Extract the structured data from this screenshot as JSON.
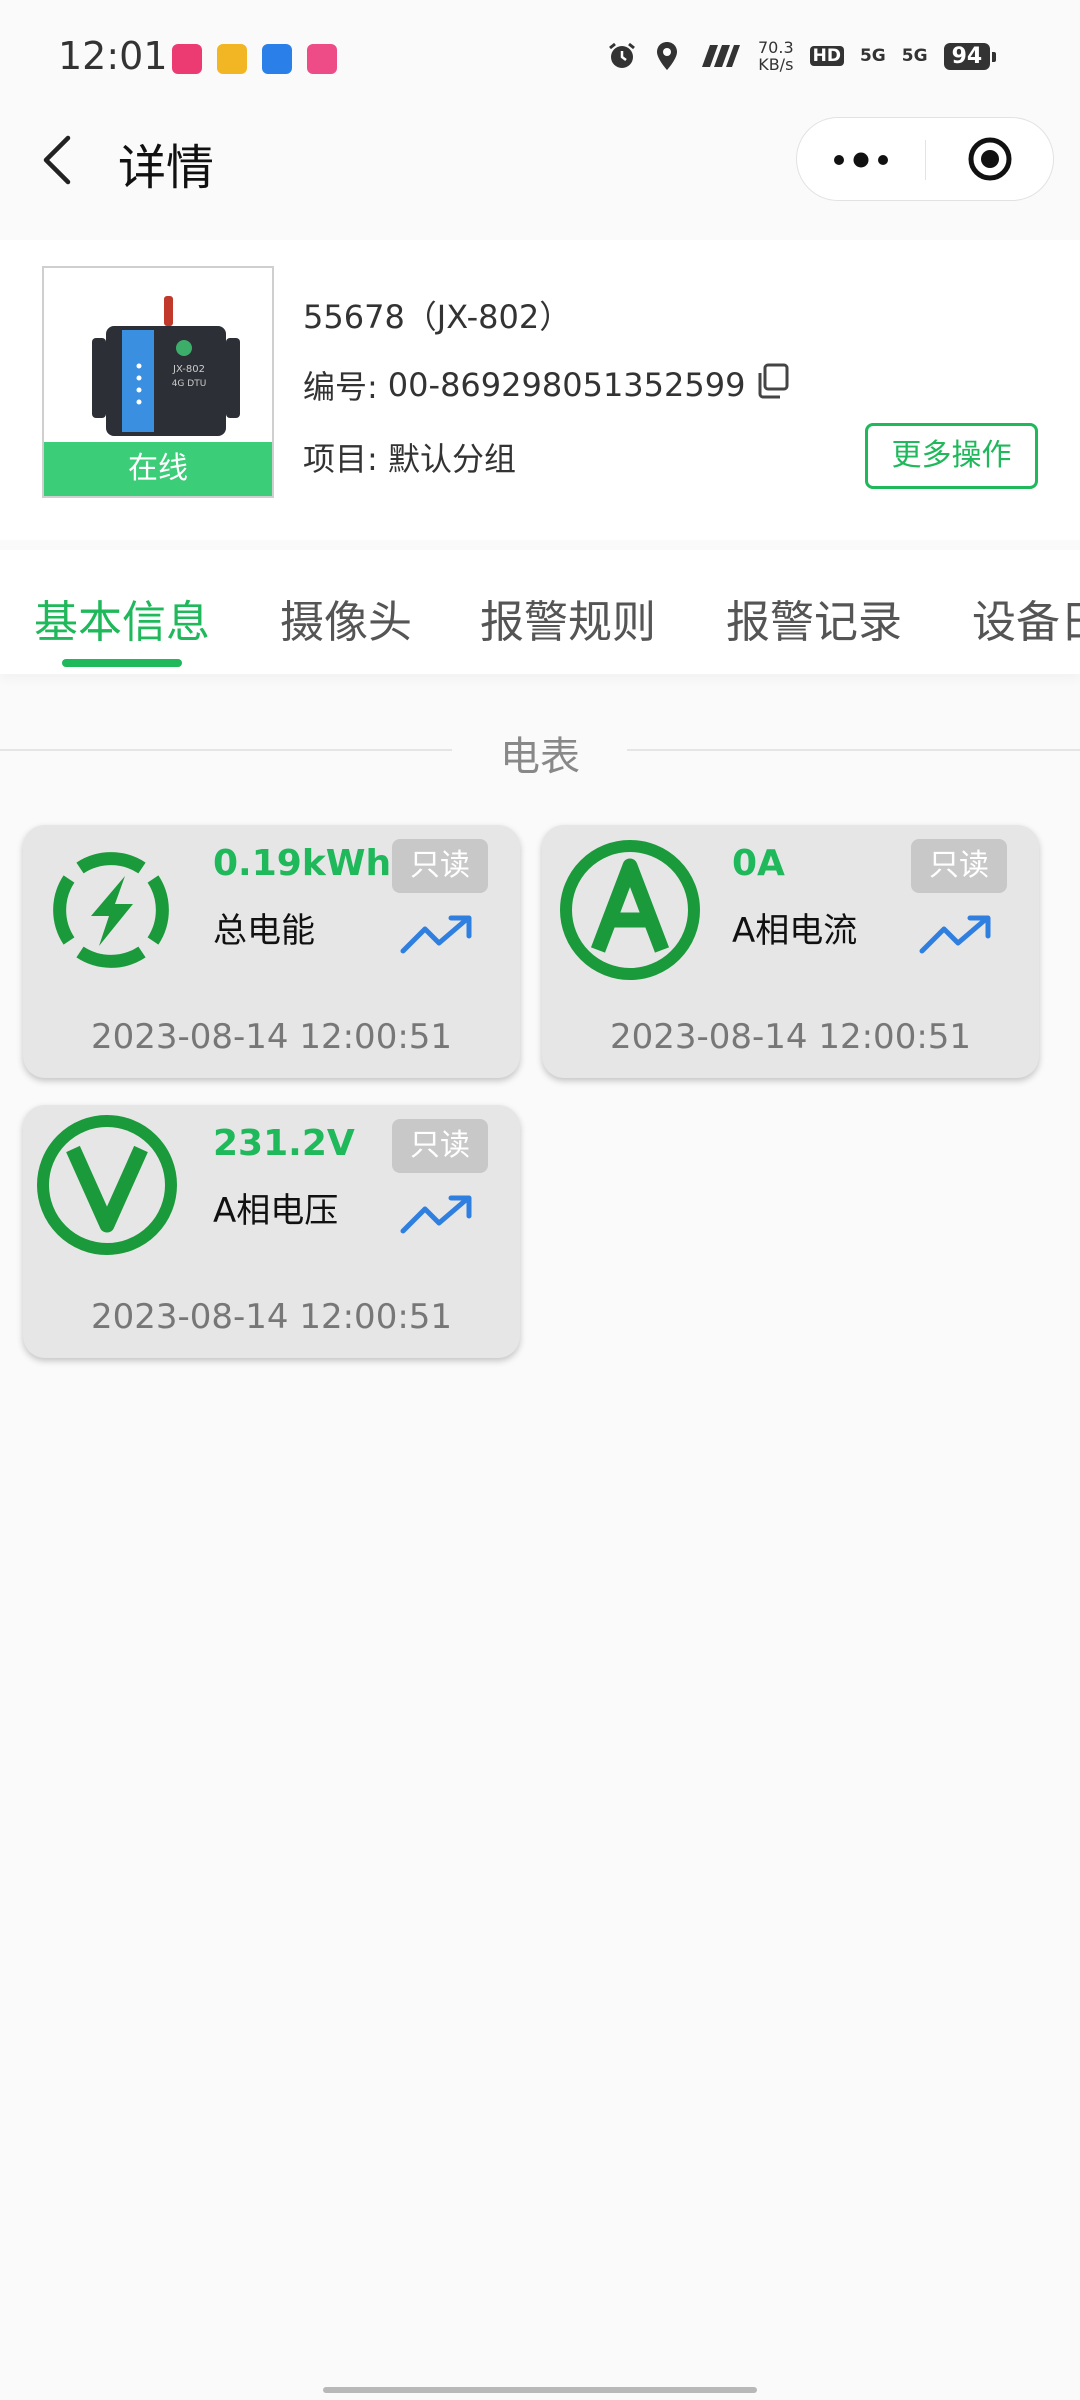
{
  "status_bar": {
    "time": "12:01",
    "net_speed_value": "70.3",
    "net_speed_unit": "KB/s",
    "hd_label": "HD",
    "sim1_label": "5G",
    "sim2_label": "5G",
    "battery": "94",
    "app_icon_colors": [
      "#ec3b73",
      "#f2b624",
      "#2b7fe8",
      "#ee4c86"
    ]
  },
  "header": {
    "title": "详情",
    "back_icon": "chevron-left-icon",
    "more_icon": "more-dots-icon",
    "target_icon": "target-icon"
  },
  "device": {
    "name": "55678（JX-802）",
    "serial_label": "编号:",
    "serial_value": "00-869298051352599",
    "project_label": "项目:",
    "project_value": "默认分组",
    "status": "在线",
    "image_text": [
      "JX-802",
      "4G DTU"
    ],
    "more_ops_label": "更多操作"
  },
  "tabs": [
    {
      "label": "基本信息",
      "active": true
    },
    {
      "label": "摄像头",
      "active": false
    },
    {
      "label": "报警规则",
      "active": false
    },
    {
      "label": "报警记录",
      "active": false
    },
    {
      "label": "设备日",
      "active": false
    }
  ],
  "section": {
    "title": "电表"
  },
  "cards": [
    {
      "value": "0.19kWh",
      "label": "总电能",
      "badge": "只读",
      "time": "2023-08-14 12:00:51",
      "icon": "lightning-icon"
    },
    {
      "value": "0A",
      "label": "A相电流",
      "badge": "只读",
      "time": "2023-08-14 12:00:51",
      "icon": "ampere-icon"
    },
    {
      "value": "231.2V",
      "label": "A相电压",
      "badge": "只读",
      "time": "2023-08-14 12:00:51",
      "icon": "voltage-icon"
    }
  ],
  "colors": {
    "accent": "#1fb85a",
    "online": "#3ccd79",
    "trend": "#2f7fe0",
    "card_bg": "#e6e6e6",
    "icon_green": "#1a9a3a"
  }
}
